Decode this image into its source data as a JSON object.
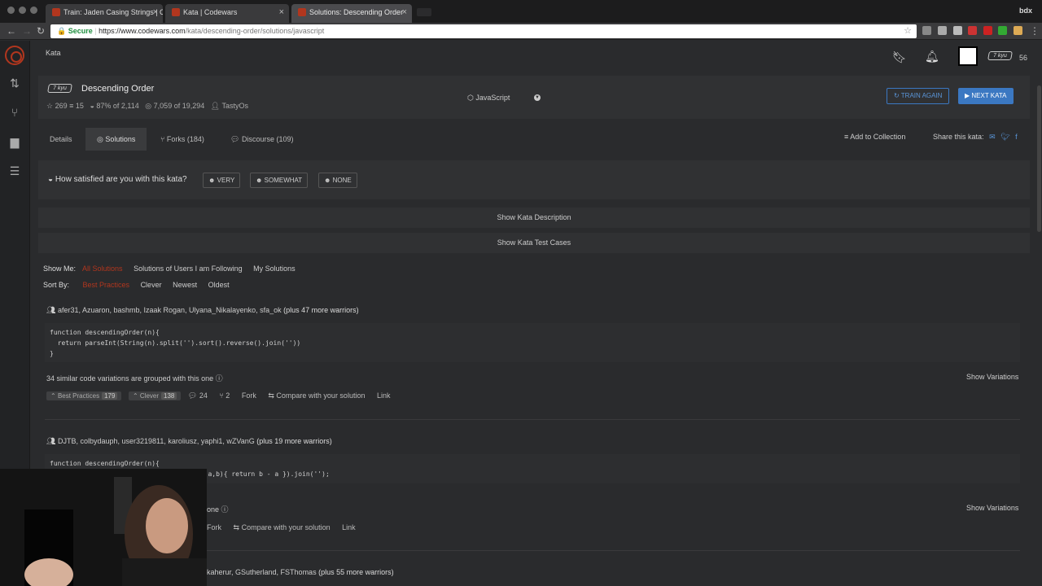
{
  "browser": {
    "tabs": [
      {
        "label": "Train: Jaden Casing Strings | C",
        "active": false
      },
      {
        "label": "Kata | Codewars",
        "active": false
      },
      {
        "label": "Solutions: Descending Order",
        "active": true
      }
    ],
    "profile": "bdx",
    "secure_label": "Secure",
    "url_host": "https://www.codewars.com",
    "url_path": "/kata/descending-order/solutions/javascript"
  },
  "topbar": {
    "breadcrumb": "Kata",
    "rank_badge": "7 kyu",
    "honor": "56"
  },
  "kata": {
    "rank": "7 kyu",
    "title": "Descending Order",
    "stars": "269",
    "collections": "15",
    "satisfaction": "87% of 2,114",
    "completed": "7,059 of 19,294",
    "author": "TastyOs",
    "language": "JavaScript",
    "train_again": "TRAIN AGAIN",
    "next_kata": "NEXT KATA"
  },
  "tabs": {
    "details": "Details",
    "solutions": "Solutions",
    "forks": "Forks (184)",
    "discourse": "Discourse (109)",
    "add_collection": "Add to Collection",
    "share": "Share this kata:"
  },
  "satisfaction": {
    "question": "How satisfied are you with this kata?",
    "very": "VERY",
    "somewhat": "SOMEWHAT",
    "none": "NONE"
  },
  "show_description": "Show Kata Description",
  "show_tests": "Show Kata Test Cases",
  "filters": {
    "show_me_label": "Show Me:",
    "show_me": [
      "All Solutions",
      "Solutions of Users I am Following",
      "My Solutions"
    ],
    "sort_by_label": "Sort By:",
    "sort_by": [
      "Best Practices",
      "Clever",
      "Newest",
      "Oldest"
    ]
  },
  "solutions": [
    {
      "warriors": "afer31, Azuaron, bashmb, Izaak Rogan, Ulyana_Nikalayenko, sfa_ok",
      "plus": "(plus 47 more warriors)",
      "code_line1": "function descendingOrder(n){",
      "code_line2": "  return parseInt(String(n).split('').sort().reverse().join(''))",
      "code_line3": "}",
      "grouped": "34 similar code variations are grouped with this one",
      "show_variations": "Show Variations",
      "best_practices": "Best Practices",
      "bp_count": "179",
      "clever": "Clever",
      "clever_count": "138",
      "comments": "24",
      "forks": "2",
      "fork": "Fork",
      "compare": "Compare with your solution",
      "link": "Link"
    },
    {
      "warriors": "DJTB, colbydauph, user3219811, karoliusz, yaphi1, wZVanG",
      "plus": "(plus 19 more warriors)",
      "code_line1": "function descendingOrder(n){",
      "code_line2": "on(a,b){ return b - a }).join('');",
      "grouped": "one",
      "show_variations": "Show Variations",
      "fork": "Fork",
      "compare": "Compare with your solution",
      "link": "Link"
    },
    {
      "warriors": "kaherur, GSutherland, FSThomas",
      "plus": "(plus 55 more warriors)"
    }
  ]
}
